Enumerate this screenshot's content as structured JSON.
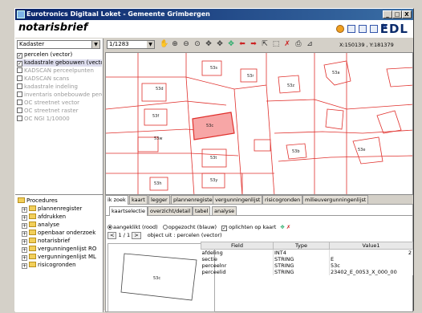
{
  "window": {
    "title": "Eurotronics Digitaal Loket - Gemeente Grimbergen",
    "min": "_",
    "max": "□",
    "close": "X"
  },
  "app": {
    "title": "notarisbrief",
    "logo": "EDL"
  },
  "layers": {
    "selected": "Kadaster",
    "items": [
      {
        "label": "percelen (vector)",
        "checked": true,
        "enabled": true
      },
      {
        "label": "kadastrale gebouwen (vector",
        "checked": true,
        "enabled": true
      },
      {
        "label": "KADSCAN perceelpunten",
        "checked": false,
        "enabled": false
      },
      {
        "label": "KADSCAN scans",
        "checked": false,
        "enabled": false
      },
      {
        "label": "kadastrale indeling",
        "checked": false,
        "enabled": false
      },
      {
        "label": "inventaris onbebouwde perce",
        "checked": false,
        "enabled": false
      },
      {
        "label": "OC streetnet vector",
        "checked": false,
        "enabled": false
      },
      {
        "label": "OC streetnet raster",
        "checked": false,
        "enabled": false
      },
      {
        "label": "OC NGI 1/10000",
        "checked": false,
        "enabled": false
      }
    ]
  },
  "toolbar": {
    "scale": "1/1283",
    "coords": "X:150139 , Y:181379"
  },
  "map": {
    "parcel_labels": [
      "53d",
      "53s",
      "53r",
      "53f",
      "53w",
      "53z",
      "53a",
      "53c",
      "53t",
      "53y",
      "53b",
      "53e",
      "53h"
    ],
    "highlight_label": "53c"
  },
  "tree": {
    "root": "Procedures",
    "items": [
      "plannenregister",
      "afdrukken",
      "analyse",
      "openbaar onderzoek",
      "notarisbrief",
      "vergunningenlijst RO",
      "vergunningenlijst ML",
      "risicogronden"
    ]
  },
  "tabs": [
    "ik zoek",
    "kaart",
    "legger",
    "plannenregister",
    "vergunningenlijst",
    "risicogronden",
    "milieuvergunningenlijst"
  ],
  "subtabs": [
    "kaartselectie",
    "overzicht/detail",
    "tabel",
    "analyse"
  ],
  "options": {
    "radio1": "aangeklikt (rood)",
    "radio2": "opgezocht (blauw)",
    "check": "oplichten op kaart"
  },
  "navigator": {
    "prev": "<",
    "page": "1 / 1",
    "next": ">",
    "object": "object uit : percelen (vector)"
  },
  "minimap_label": "53c",
  "table": {
    "headers": [
      "Field",
      "Type",
      "Value1"
    ],
    "rows": [
      [
        "afdeling",
        "INT4",
        "2"
      ],
      [
        "sectie",
        "STRING",
        "E"
      ],
      [
        "perceelnr",
        "STRING",
        "53c"
      ],
      [
        "perceelid",
        "STRING",
        "23402_E_0053_X_000_00"
      ]
    ]
  },
  "colors": {
    "parcel": "#e0302c",
    "highlight": "#f7a6a6",
    "titlebar": "#0a246a"
  }
}
